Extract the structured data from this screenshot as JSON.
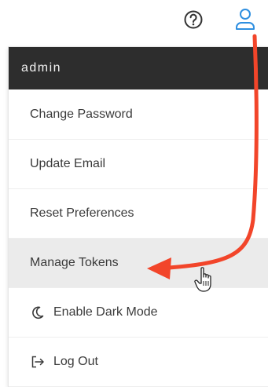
{
  "header": {
    "help_icon": "question-circle-icon",
    "user_icon": "user-icon"
  },
  "menu": {
    "username": "admin",
    "items": [
      {
        "label": "Change Password"
      },
      {
        "label": "Update Email"
      },
      {
        "label": "Reset Preferences"
      },
      {
        "label": "Manage Tokens",
        "hovered": true
      },
      {
        "label": "Enable Dark Mode",
        "icon": "moon-icon"
      },
      {
        "label": "Log Out",
        "icon": "logout-icon"
      }
    ]
  },
  "colors": {
    "header_bg": "#2d2d2d",
    "hover_bg": "#ebebeb",
    "accent_blue": "#2f8fe0",
    "annotation_arrow": "#f2452a"
  }
}
